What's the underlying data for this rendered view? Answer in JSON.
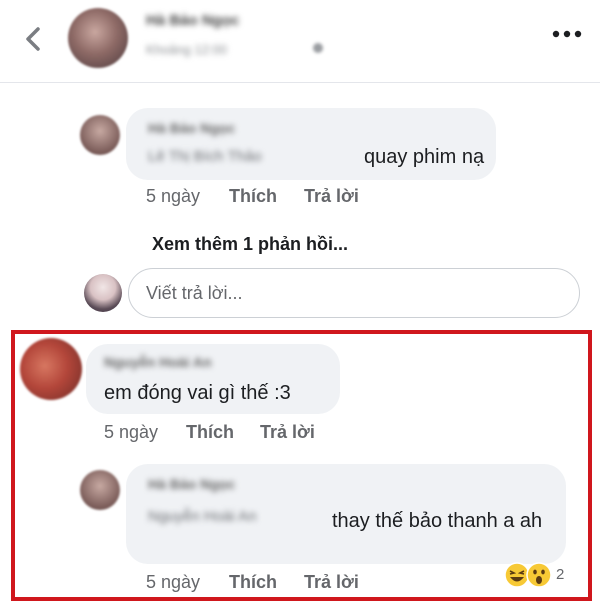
{
  "header": {
    "back_icon": "back-arrow-icon",
    "author_name": "Hà Bảo Ngọc",
    "post_time": "Khoảng 12:00",
    "privacy_icon": "globe-icon",
    "more_icon": "more-options-icon"
  },
  "reply1": {
    "author": "Hà Bảo Ngọc",
    "mention": "Lê Thị Bích Thảo",
    "text": "quay phim nạ",
    "time": "5 ngày",
    "like": "Thích",
    "reply": "Trả lời"
  },
  "see_more": "Xem thêm 1 phản hồi...",
  "reply_input": {
    "placeholder": "Viết trả lời..."
  },
  "comment2": {
    "author": "Nguyễn Hoài An",
    "text": "em đóng vai gì thế :3",
    "time": "5 ngày",
    "like": "Thích",
    "reply": "Trả lời"
  },
  "reply2": {
    "author": "Hà Bảo Ngọc",
    "mention": "Nguyễn Hoài An",
    "text": "thay thế bảo thanh a ah",
    "time": "5 ngày",
    "like": "Thích",
    "reply": "Trả lời",
    "reaction_count": "2",
    "reactions": [
      "laugh-emoji-icon",
      "wow-emoji-icon"
    ]
  },
  "highlight_color": "#d0171d"
}
